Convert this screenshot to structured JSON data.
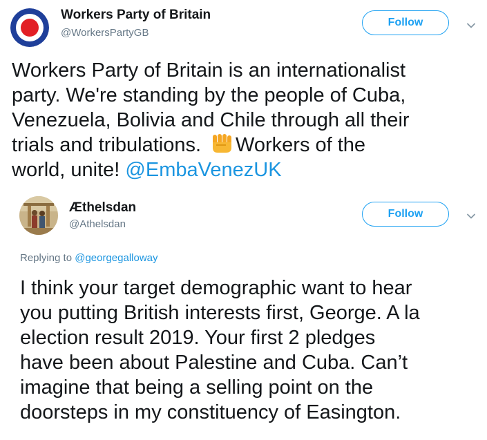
{
  "tweet1": {
    "display_name": "Workers Party of Britain",
    "handle": "@WorkersPartyGB",
    "follow_label": "Follow",
    "body_lines": [
      "Workers Party of Britain is an internationalist",
      "party. We're standing by the people of Cuba,",
      "Venezuela, Bolivia and Chile through all their"
    ],
    "line4_before": "trials and tribulations.",
    "line4_after": "Workers of the",
    "line5_text": "world, unite! ",
    "line5_mention": "@EmbaVenezUK",
    "avatar_icon": "roundel-icon",
    "emoji_icon": "raised-fist-icon"
  },
  "tweet2": {
    "display_name": "Æthelsdan",
    "handle": "@Athelsdan",
    "follow_label": "Follow",
    "replying_prefix": "Replying to ",
    "replying_mention": "@georgegalloway",
    "body_lines": [
      "I think your target demographic want to hear",
      "you putting British interests first, George. A la",
      "election result 2019. Your first 2 pledges",
      "have been about Palestine and Cuba. Can’t",
      "imagine that being a selling point on the",
      "doorsteps in my constituency of Easington."
    ]
  },
  "colors": {
    "accent": "#1da1f2",
    "mention": "#1b95e0",
    "secondary_text": "#657786",
    "primary_text": "#14171a"
  }
}
